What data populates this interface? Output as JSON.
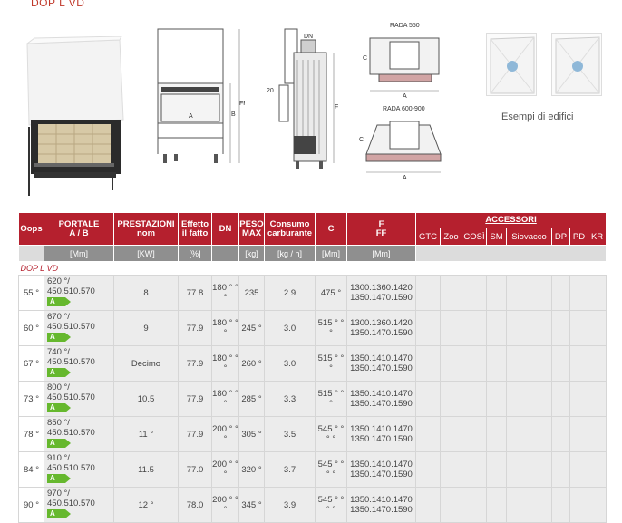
{
  "title": "DOP L VD",
  "drawings": {
    "rada550": "RADA 550",
    "rada600": "RADA 600-900",
    "dn": "DN",
    "c": "C",
    "a": "A",
    "b": "B",
    "ff": "FF",
    "f": "F",
    "d20": "20"
  },
  "examples_caption": "Esempi di edifici",
  "table": {
    "headers": {
      "oops": "Oops",
      "portale": "PORTALE\nA / B",
      "prestazioni": "PRESTAZIONI\nnom",
      "effetto": "Effetto\nil fatto",
      "dn": "DN",
      "peso": "PESO\nMAX",
      "consumo": "Consumo\ncarburante",
      "c": "C",
      "f": "F\nFF",
      "accessori": "ACCESSORI"
    },
    "accessori": [
      "GTC",
      "Zoo",
      "COSÌ",
      "SM",
      "Siovacco",
      "DP",
      "PD",
      "KR"
    ],
    "units": [
      "[Mm]",
      "[KW]",
      "[%]",
      "",
      "[kg]",
      "[kg / h]",
      "[Mm]",
      "[Mm]"
    ],
    "group": "DOP L VD",
    "dot": "•",
    "rows": [
      {
        "oops": "55 °",
        "p1": "620 °/",
        "p2": "450.510.570",
        "energy": "A",
        "kw": "8",
        "eff": "77.8",
        "dn": "180 ° ° °",
        "peso": "235",
        "cons": "2.9",
        "c": "475 °",
        "f1": "1300.1360.1420",
        "f2": "1350.1470.1590"
      },
      {
        "oops": "60 °",
        "p1": "670 °/",
        "p2": "450.510.570",
        "energy": "A",
        "kw": "9",
        "eff": "77.9",
        "dn": "180 ° ° °",
        "peso": "245 °",
        "cons": "3.0",
        "c": "515 ° ° °",
        "f1": "1300.1360.1420",
        "f2": "1350.1470.1590"
      },
      {
        "oops": "67 °",
        "p1": "740 °/",
        "p2": "450.510.570",
        "energy": "A",
        "kw": "Decimo",
        "eff": "77.9",
        "dn": "180 ° ° °",
        "peso": "260 °",
        "cons": "3.0",
        "c": "515 ° ° °",
        "f1": "1350.1410.1470",
        "f2": "1350.1470.1590"
      },
      {
        "oops": "73 °",
        "p1": "800 °/",
        "p2": "450.510.570",
        "energy": "A",
        "kw": "10.5",
        "eff": "77.9",
        "dn": "180 ° ° °",
        "peso": "285 °",
        "cons": "3.3",
        "c": "515 ° ° °",
        "f1": "1350.1410.1470",
        "f2": "1350.1470.1590"
      },
      {
        "oops": "78 °",
        "p1": "850 °/",
        "p2": "450.510.570",
        "energy": "A",
        "kw": "11 °",
        "eff": "77.9",
        "dn": "200 ° ° °",
        "peso": "305 °",
        "cons": "3.5",
        "c": "545 ° ° ° °",
        "f1": "1350.1410.1470",
        "f2": "1350.1470.1590"
      },
      {
        "oops": "84 °",
        "p1": "910 °/",
        "p2": "450.510.570",
        "energy": "A",
        "kw": "11.5",
        "eff": "77.0",
        "dn": "200 ° ° °",
        "peso": "320 °",
        "cons": "3.7",
        "c": "545 ° ° ° °",
        "f1": "1350.1410.1470",
        "f2": "1350.1470.1590"
      },
      {
        "oops": "90 °",
        "p1": "970 °/",
        "p2": "450.510.570",
        "energy": "A",
        "kw": "12 °",
        "eff": "78.0",
        "dn": "200 ° ° °",
        "peso": "345 °",
        "cons": "3.9",
        "c": "545 ° ° ° °",
        "f1": "1350.1410.1470",
        "f2": "1350.1470.1590"
      }
    ]
  },
  "colors": {
    "header": "#b5202e",
    "units": "#8f8f8f",
    "energy": "#66b82e"
  }
}
